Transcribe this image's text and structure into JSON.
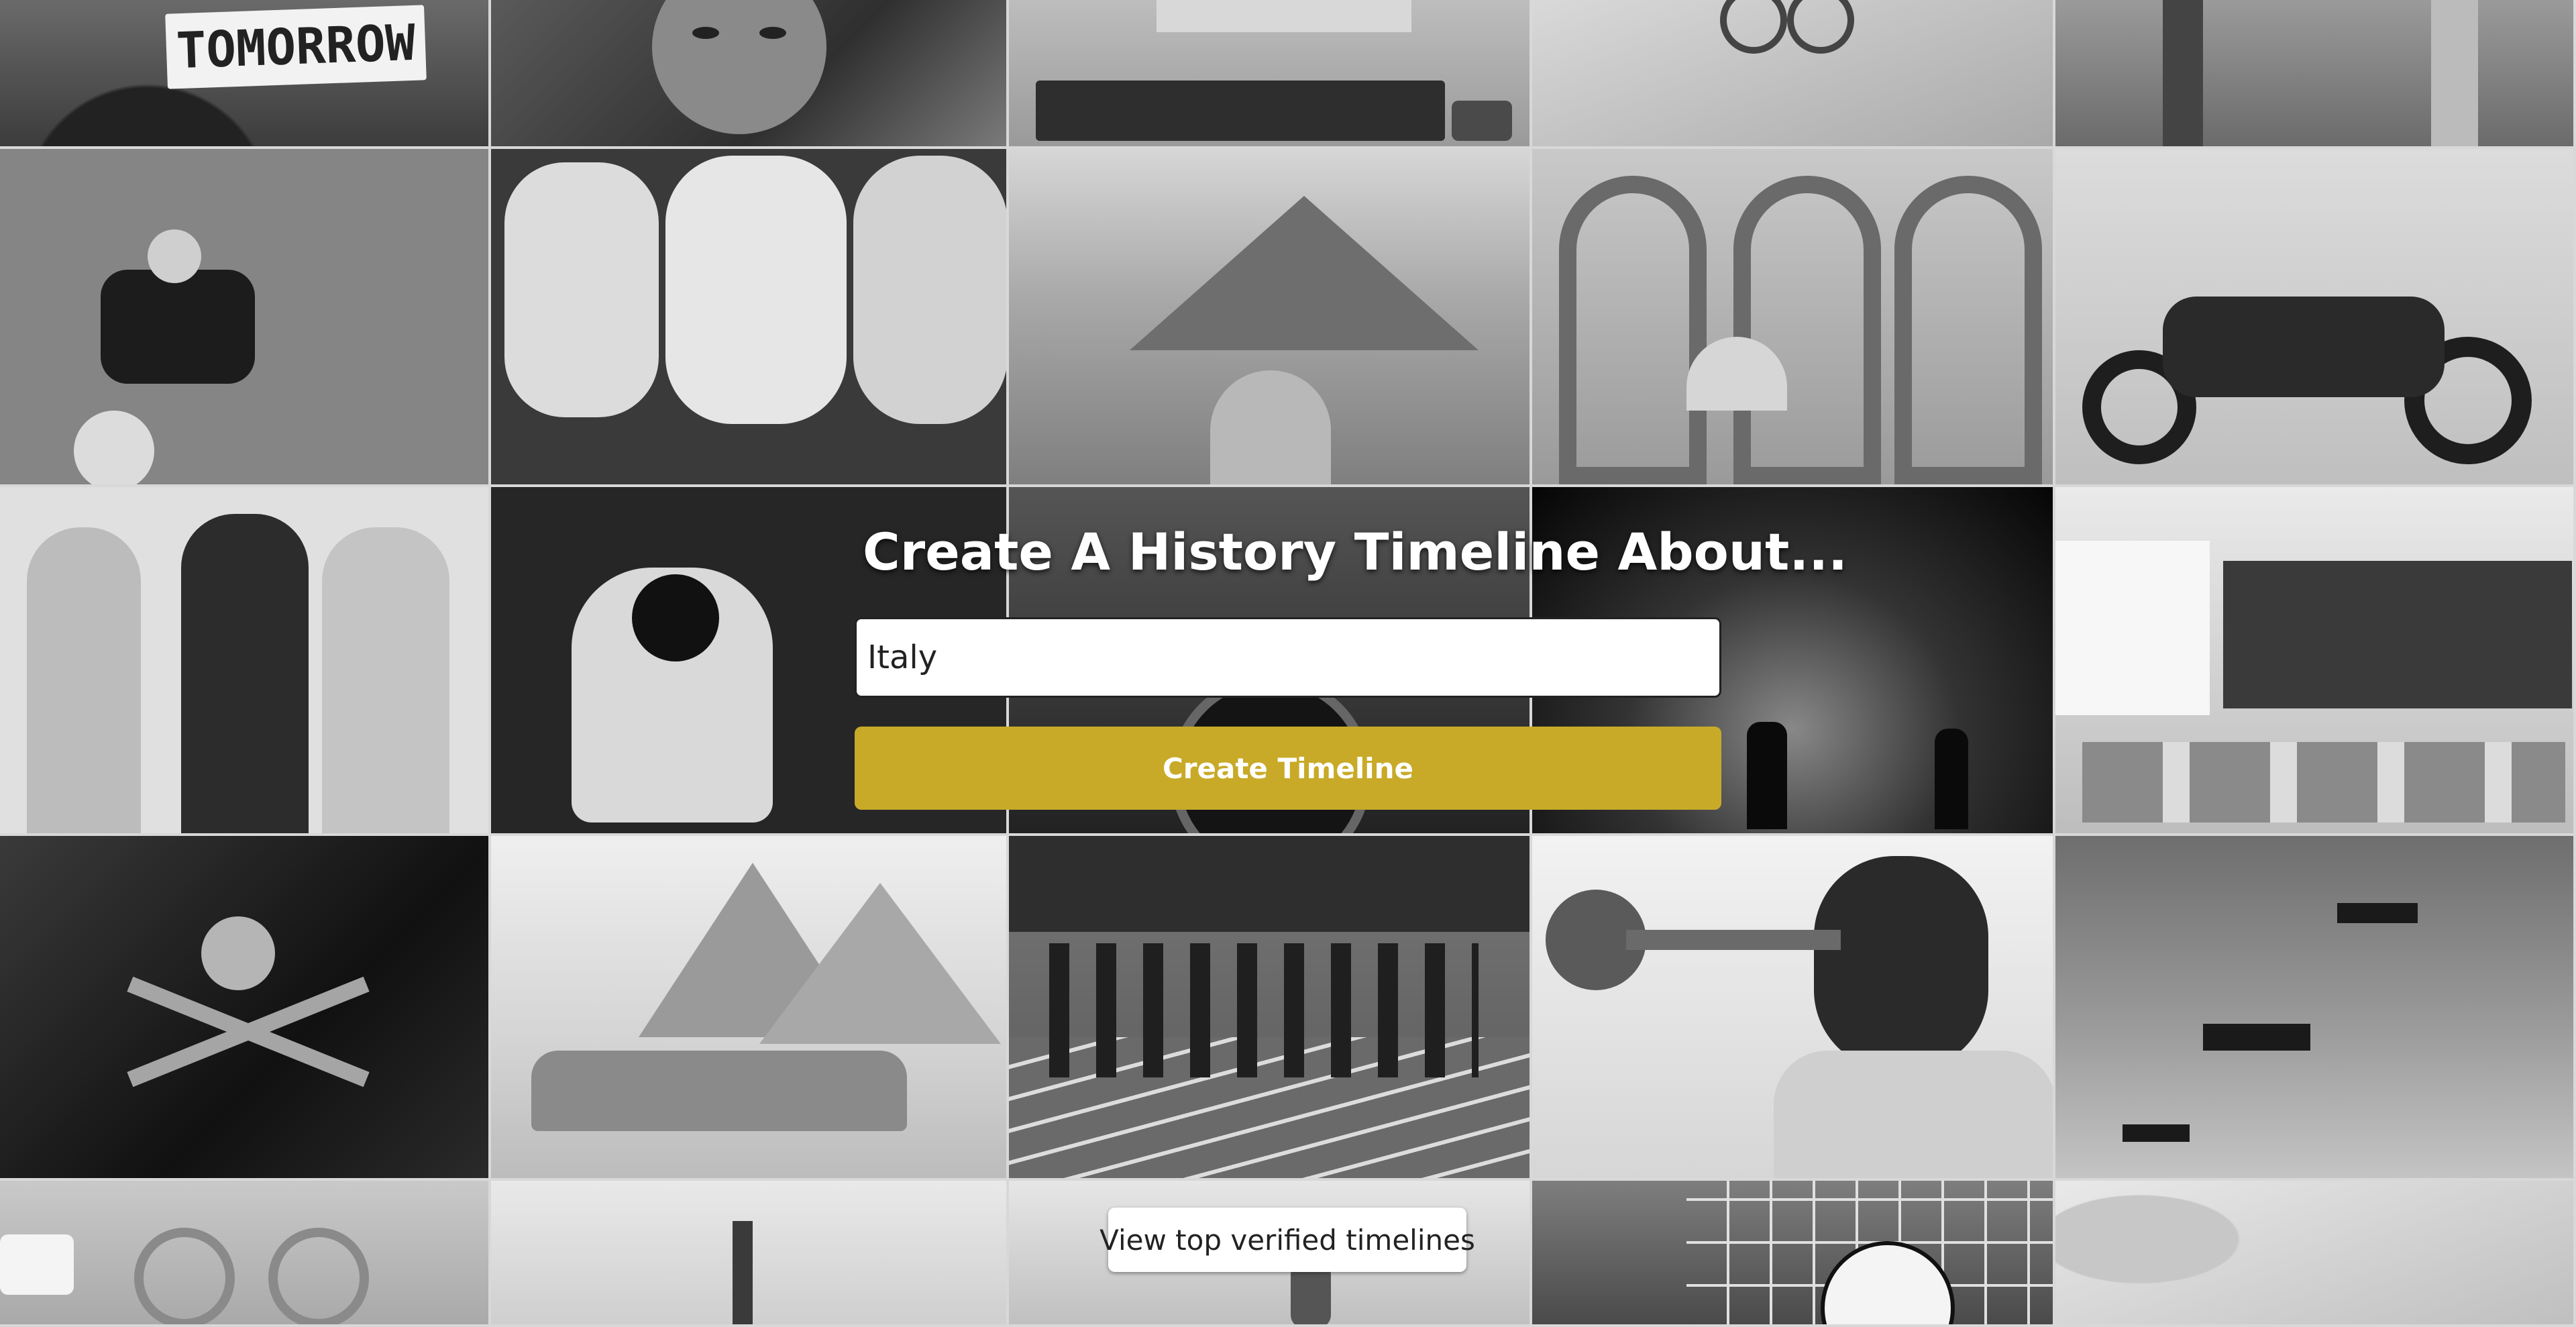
{
  "hero": {
    "title": "Create A History Timeline About...",
    "input_value": "Italy",
    "button_label": "Create Timeline",
    "verified_link_label": "View top verified timelines"
  },
  "background": {
    "sign_text": "TOMORROW",
    "tiles": [
      {
        "name": "protest-sign-photo",
        "tone": "#7a7a7a"
      },
      {
        "name": "frida-portrait-photo",
        "tone": "#5a5a5a"
      },
      {
        "name": "vintage-computer-photo",
        "tone": "#b5b5b5"
      },
      {
        "name": "handcuffs-documents-photo",
        "tone": "#c9c9c9"
      },
      {
        "name": "street-crowd-photo",
        "tone": "#8d8d8d"
      },
      {
        "name": "tennis-player-photo",
        "tone": "#7d7d7d"
      },
      {
        "name": "paper-lanterns-photo",
        "tone": "#a8a8a8"
      },
      {
        "name": "volcano-arch-photo",
        "tone": "#9c9c9c"
      },
      {
        "name": "dome-arches-photo",
        "tone": "#b8b8b8"
      },
      {
        "name": "motorcycle-photo",
        "tone": "#c4c4c4"
      },
      {
        "name": "retro-women-photo",
        "tone": "#9a9a9a"
      },
      {
        "name": "astronaut-photo",
        "tone": "#2b2b2b"
      },
      {
        "name": "film-camera-photo",
        "tone": "#3a3a3a"
      },
      {
        "name": "concert-stage-photo",
        "tone": "#1c1c1c"
      },
      {
        "name": "classroom-photo",
        "tone": "#c2c2c2"
      },
      {
        "name": "pirate-flag-photo",
        "tone": "#2a2a2a"
      },
      {
        "name": "pyramids-sphinx-photo",
        "tone": "#cfcfcf"
      },
      {
        "name": "running-track-photo",
        "tone": "#6b6b6b"
      },
      {
        "name": "trumpet-player-photo",
        "tone": "#8a8a8a"
      },
      {
        "name": "warplanes-photo",
        "tone": "#8f8f8f"
      },
      {
        "name": "olympic-rings-photo",
        "tone": "#bdbdbd"
      },
      {
        "name": "guitar-photo",
        "tone": "#d7d7d7"
      },
      {
        "name": "medical-supplies-photo",
        "tone": "#d0d0d0"
      },
      {
        "name": "soccer-ball-net-photo",
        "tone": "#7c7c7c"
      },
      {
        "name": "map-photo",
        "tone": "#d9d9d9"
      }
    ]
  }
}
